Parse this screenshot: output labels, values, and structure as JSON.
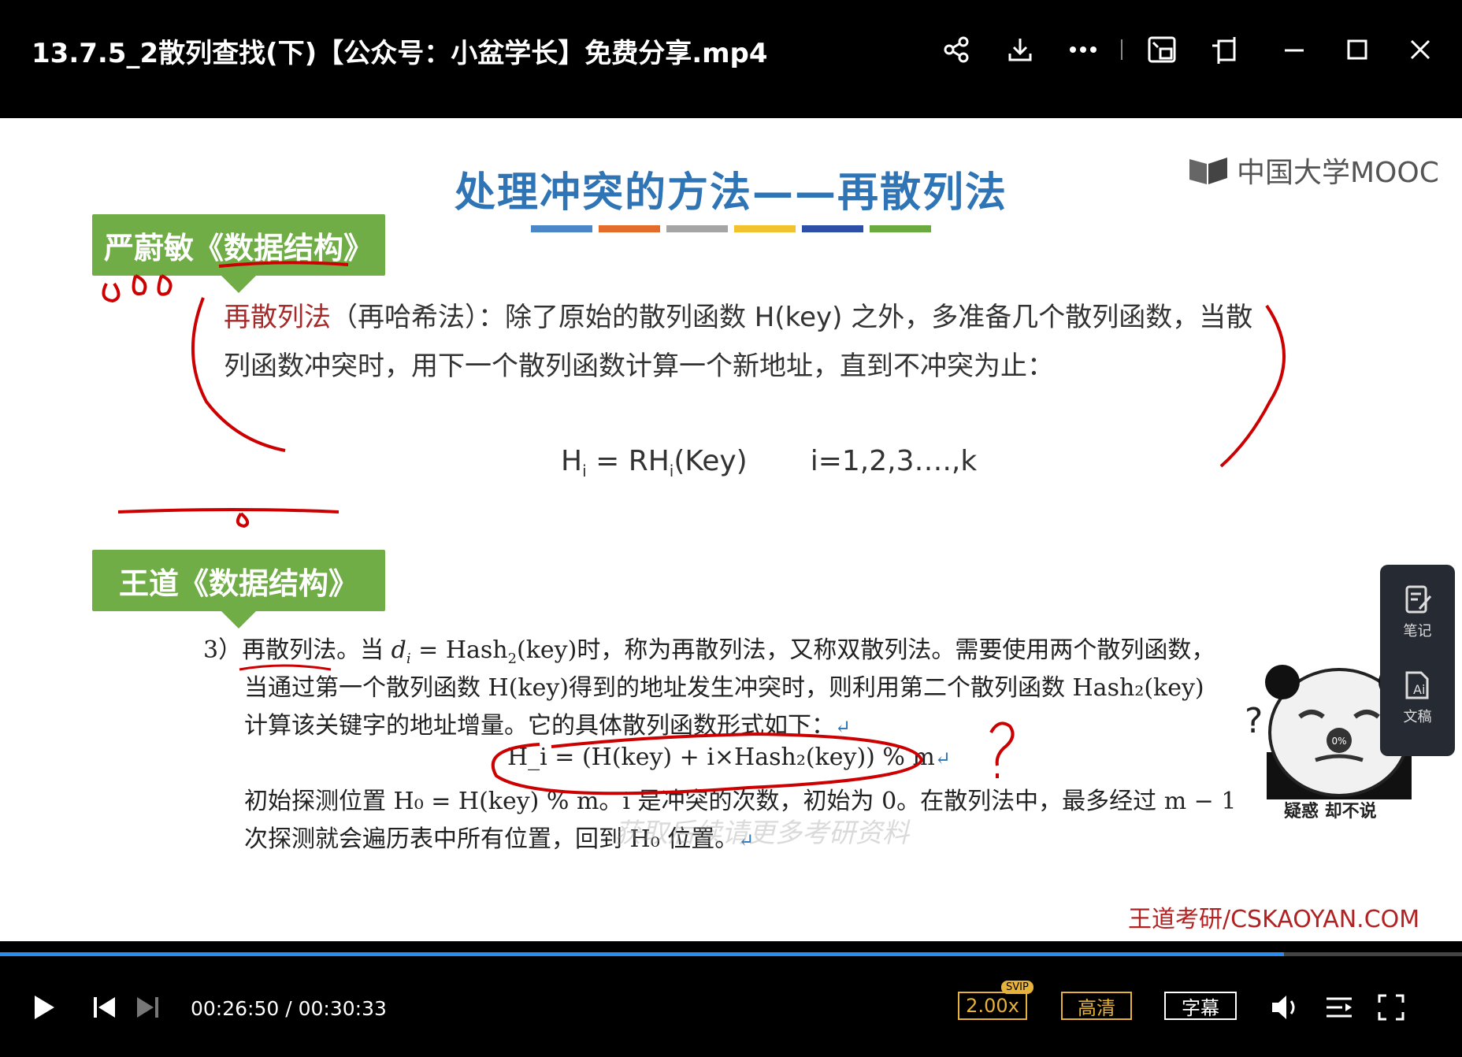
{
  "window": {
    "title": "13.7.5_2散列查找(下)【公众号：小盆学长】免费分享.mp4",
    "icons": [
      "share-icon",
      "download-icon",
      "more-icon",
      "picture-in-picture-icon",
      "rotate-icon",
      "minimize-icon",
      "maximize-icon",
      "close-icon"
    ]
  },
  "slide": {
    "title": "处理冲突的方法——再散列法",
    "color_bars": [
      "#4a86c8",
      "#e36c2a",
      "#a5a5a5",
      "#f2c12e",
      "#2e4fa8",
      "#6aaa3f"
    ],
    "logo_text": "中国大学MOOC",
    "tag1": "严蔚敏《数据结构》",
    "para1_highlight": "再散列法",
    "para1_rest": "（再哈希法）：除了原始的散列函数 H(key) 之外，多准备几个散列函数，当散列函数冲突时，用下一个散列函数计算一个新地址，直到不冲突为止：",
    "formula_left": "H",
    "formula_sub_i": "i",
    "formula_mid": " = RH",
    "formula_key": "(Key)",
    "formula_range": "i=1,2,3….,k",
    "tag2": "王道《数据结构》",
    "book": {
      "l1_a": "3）再散列法。当 ",
      "l1_di": "d",
      "l1_b": " = Hash",
      "l1_c": "(key)时，称为再散列法，又称双散列法。需要使用两个散列函数，",
      "l2": "当通过第一个散列函数 H(key)得到的地址发生冲突时，则利用第二个散列函数 Hash₂(key)",
      "l3": "计算该关键字的地址增量。它的具体散列函数形式如下：",
      "l4": "H_i = (H(key) + i×Hash₂(key)) % m",
      "l5": "初始探测位置 H₀ = H(key) % m。i 是冲突的次数，初始为 0。在散列法中，最多经过 m − 1",
      "l6": "次探测就会遍历表中所有位置，回到 H₀ 位置。",
      "return_mark": "↵"
    },
    "watermark": "获取后续请更多考研资料",
    "meme_caption": "疑惑 却不说",
    "meme_progress": "0%",
    "site": "王道考研/CSKAOYAN.COM"
  },
  "side_panel": {
    "notes": "笔记",
    "transcript": "文稿"
  },
  "player": {
    "current_time": "00:26:50",
    "total_time": "00:30:33",
    "time_display": "00:26:50 / 00:30:33",
    "progress": 0.878,
    "speed": "2.00x",
    "svip": "SVIP",
    "quality": "高清",
    "subtitle": "字幕"
  }
}
